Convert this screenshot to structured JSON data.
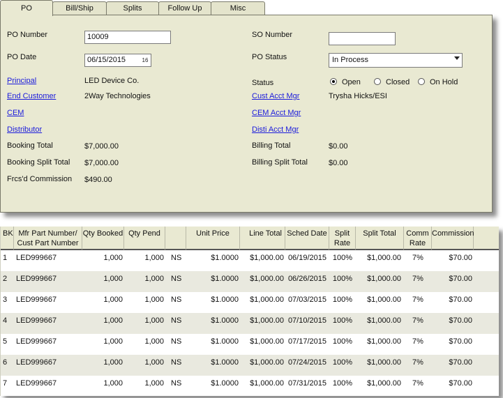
{
  "tabs": [
    {
      "label": "PO",
      "active": true
    },
    {
      "label": "Bill/Ship",
      "active": false
    },
    {
      "label": "Splits",
      "active": false
    },
    {
      "label": "Follow Up",
      "active": false
    },
    {
      "label": "Misc",
      "active": false
    }
  ],
  "form": {
    "po_number_label": "PO Number",
    "po_number_value": "10009",
    "po_date_label": "PO Date",
    "po_date_value": "06/15/2015",
    "calendar_icon_text": "16",
    "principal_label": "Principal",
    "principal_value": "LED Device Co.",
    "end_customer_label": "End Customer",
    "end_customer_value": "2Way Technologies",
    "cem_label": "CEM",
    "distributor_label": "Distributor",
    "booking_total_label": "Booking Total",
    "booking_total_value": "$7,000.00",
    "booking_split_total_label": "Booking Split Total",
    "booking_split_total_value": "$7,000.00",
    "frcs_commission_label": "Frcs'd Commission",
    "frcs_commission_value": "$490.00",
    "so_number_label": "SO Number",
    "so_number_value": "",
    "po_status_label": "PO Status",
    "po_status_value": "In Process",
    "status_label": "Status",
    "status_options": [
      "Open",
      "Closed",
      "On Hold"
    ],
    "status_selected": "Open",
    "cust_acct_mgr_label": "Cust Acct Mgr",
    "cust_acct_mgr_value": "Trysha Hicks/ESI",
    "cem_acct_mgr_label": "CEM Acct Mgr",
    "disti_acct_mgr_label": "Disti Acct Mgr",
    "billing_total_label": "Billing Total",
    "billing_total_value": "$0.00",
    "billing_split_total_label": "Billing Split Total",
    "billing_split_total_value": "$0.00"
  },
  "grid": {
    "headers": {
      "bk": "BK",
      "mfr_part_1": "Mfr Part Number/",
      "mfr_part_2": "Cust Part Number",
      "qty_booked": "Qty Booked",
      "qty_pend": "Qty Pend",
      "blank": "",
      "unit_price": "Unit Price",
      "line_total": "Line Total",
      "sched_date": "Sched Date",
      "split_rate_1": "Split",
      "split_rate_2": "Rate",
      "split_total": "Split Total",
      "comm_rate_1": "Comm",
      "comm_rate_2": "Rate",
      "commission": "Commission"
    },
    "rows": [
      {
        "bk": "1",
        "part": "LED999667",
        "qty_booked": "1,000",
        "qty_pend": "1,000",
        "uom": "NS",
        "unit_price": "$1.0000",
        "line_total": "$1,000.00",
        "sched_date": "06/19/2015",
        "split_rate": "100%",
        "split_total": "$1,000.00",
        "comm_rate": "7%",
        "commission": "$70.00"
      },
      {
        "bk": "2",
        "part": "LED999667",
        "qty_booked": "1,000",
        "qty_pend": "1,000",
        "uom": "NS",
        "unit_price": "$1.0000",
        "line_total": "$1,000.00",
        "sched_date": "06/26/2015",
        "split_rate": "100%",
        "split_total": "$1,000.00",
        "comm_rate": "7%",
        "commission": "$70.00"
      },
      {
        "bk": "3",
        "part": "LED999667",
        "qty_booked": "1,000",
        "qty_pend": "1,000",
        "uom": "NS",
        "unit_price": "$1.0000",
        "line_total": "$1,000.00",
        "sched_date": "07/03/2015",
        "split_rate": "100%",
        "split_total": "$1,000.00",
        "comm_rate": "7%",
        "commission": "$70.00"
      },
      {
        "bk": "4",
        "part": "LED999667",
        "qty_booked": "1,000",
        "qty_pend": "1,000",
        "uom": "NS",
        "unit_price": "$1.0000",
        "line_total": "$1,000.00",
        "sched_date": "07/10/2015",
        "split_rate": "100%",
        "split_total": "$1,000.00",
        "comm_rate": "7%",
        "commission": "$70.00"
      },
      {
        "bk": "5",
        "part": "LED999667",
        "qty_booked": "1,000",
        "qty_pend": "1,000",
        "uom": "NS",
        "unit_price": "$1.0000",
        "line_total": "$1,000.00",
        "sched_date": "07/17/2015",
        "split_rate": "100%",
        "split_total": "$1,000.00",
        "comm_rate": "7%",
        "commission": "$70.00"
      },
      {
        "bk": "6",
        "part": "LED999667",
        "qty_booked": "1,000",
        "qty_pend": "1,000",
        "uom": "NS",
        "unit_price": "$1.0000",
        "line_total": "$1,000.00",
        "sched_date": "07/24/2015",
        "split_rate": "100%",
        "split_total": "$1,000.00",
        "comm_rate": "7%",
        "commission": "$70.00"
      },
      {
        "bk": "7",
        "part": "LED999667",
        "qty_booked": "1,000",
        "qty_pend": "1,000",
        "uom": "NS",
        "unit_price": "$1.0000",
        "line_total": "$1,000.00",
        "sched_date": "07/31/2015",
        "split_rate": "100%",
        "split_total": "$1,000.00",
        "comm_rate": "7%",
        "commission": "$70.00"
      }
    ]
  }
}
